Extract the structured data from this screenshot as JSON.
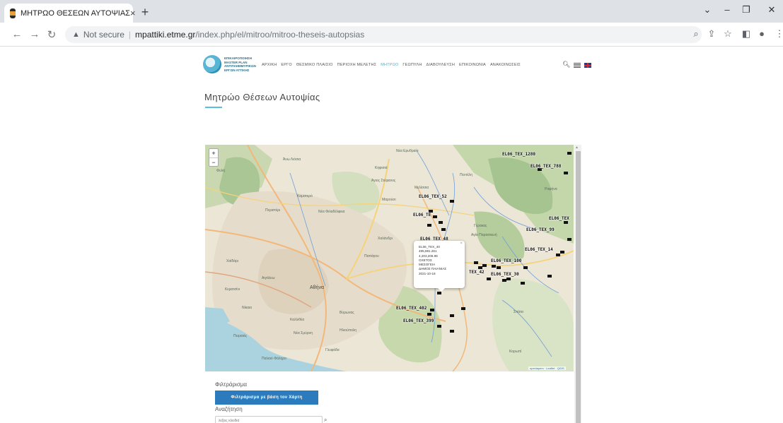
{
  "browser": {
    "tab_title": "ΜΗΤΡΩΟ ΘΕΣΕΩΝ ΑΥΤΟΨΙΑΣ",
    "tab_close": "×",
    "new_tab": "+",
    "not_secure": "Not secure",
    "url_host": "mpattiki.etme.gr",
    "url_path": "/index.php/el/mitroo/mitroo-theseis-autopsias"
  },
  "site": {
    "logo_text": "ΕΠΙΚΑΙΡΟΠΟΙΗΣΗ\nMASTER PLAN\nΑΝΤΙΠΛΗΜΜΥΡΙΚΩΝ\nΕΡΓΩΝ ΑΤΤΙΚΗΣ",
    "nav": [
      "ΑΡΧΙΚΗ",
      "ΕΡΓΟ",
      "ΘΕΣΜΙΚΟ ΠΛΑΙΣΙΟ",
      "ΠΕΡΙΟΧΗ ΜΕΛΕΤΗΣ",
      "ΜΗΤΡΩΟ",
      "ΓΕΩΠΥΛΗ",
      "ΔΙΑΒΟΥΛΕΥΣΗ",
      "ΕΠΙΚΟΙΝΩΝΙΑ",
      "ΑΝΑΚΟΙΝΩΣΕΙΣ"
    ],
    "nav_active_index": 4,
    "accent_color": "#4ab3d9"
  },
  "page": {
    "title": "Μητρώο Θέσεων Αυτοψίας"
  },
  "map": {
    "zoom_in": "+",
    "zoom_out": "−",
    "place_labels": [
      "Νέα Ερυθραία",
      "Άνω Λιόσια",
      "Φυλή",
      "Κηφισιά",
      "Άγιος Στέφανος",
      "Μαρούσι",
      "Περιστέρι",
      "Χαλάνδρι",
      "Νέα Φιλαδέλφεια",
      "Αγία Παρασκευή",
      "Αθήνα",
      "Αιγάλεω",
      "Χαϊδάρι",
      "Κερατσίνι",
      "Πειραιάς",
      "Νίκαια",
      "Καλλιθέα",
      "Νέα Σμύρνη",
      "Γλυφάδα",
      "Παλαιό Φάληρο",
      "Σπάτα",
      "Βύρωνας",
      "Παπάγου",
      "Ηλιούπολη",
      "Κορωπί",
      "Πεντέλη",
      "Γέρακας",
      "Καματερό",
      "Μελίσσια",
      "Ραφήνα"
    ],
    "marker_labels": [
      "EL06_TEX_1280",
      "EL06_TEX_788",
      "EL06_TEX_52",
      "EL06_TE",
      "EL06_TEX",
      "EL06_TEX_99",
      "EL06_TEX_48",
      "EL06_TEX_14",
      "EL06_TEX_100",
      "TEX_42",
      "EL06_TEX_30",
      "EL06_TEX_402",
      "EL06_TEX_399"
    ],
    "popup": {
      "lines": [
        "EL06_TEX_40",
        "495,891.261",
        "4,203,206.96",
        "ΟΧΕΤΟΣ",
        "ΜΕΣΟΓΕΙΑ",
        "ΔΗΜΟΣ ΠΑΙΑΝΙΑΣ",
        "2021-10-18"
      ],
      "close": "×"
    },
    "attribution": "openlayers · Leaflet · QGIS"
  },
  "filters": {
    "label": "Φιλτράρισμα",
    "map_filter_button": "Φιλτράρισμα με βάση τον Χάρτη",
    "search_label": "Αναζήτηση",
    "search_placeholder": "λέξεις κλειδιά"
  }
}
